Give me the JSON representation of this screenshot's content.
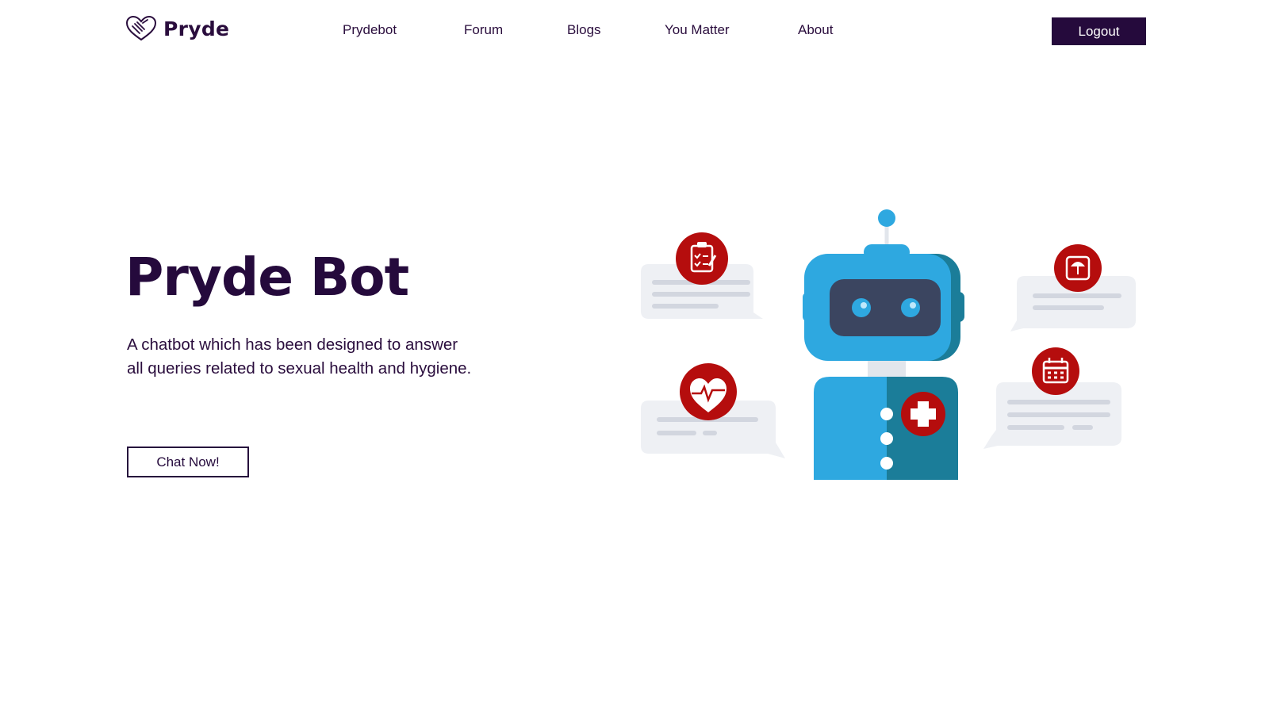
{
  "brand": {
    "name": "Pryde",
    "logo_icon": "heart-hands-icon"
  },
  "nav": {
    "items": [
      {
        "label": "Prydebot"
      },
      {
        "label": "Forum"
      },
      {
        "label": "Blogs"
      },
      {
        "label": "You Matter"
      },
      {
        "label": "About"
      }
    ],
    "logout_label": "Logout"
  },
  "hero": {
    "title": "Pryde Bot",
    "description": "A chatbot which has been designed to answer all queries related to sexual health and hygiene.",
    "cta_label": "Chat Now!"
  },
  "illustration": {
    "subject": "medical-robot-chatbot",
    "icons": [
      "clipboard-icon",
      "scale-icon",
      "heart-pulse-icon",
      "calendar-icon",
      "medical-cross-icon"
    ]
  },
  "colors": {
    "brand_dark": "#250a3c",
    "robot_blue": "#2ea8e0",
    "robot_teal": "#1b7d99",
    "icon_red": "#b50d0d",
    "bubble_gray": "#eef0f4"
  }
}
